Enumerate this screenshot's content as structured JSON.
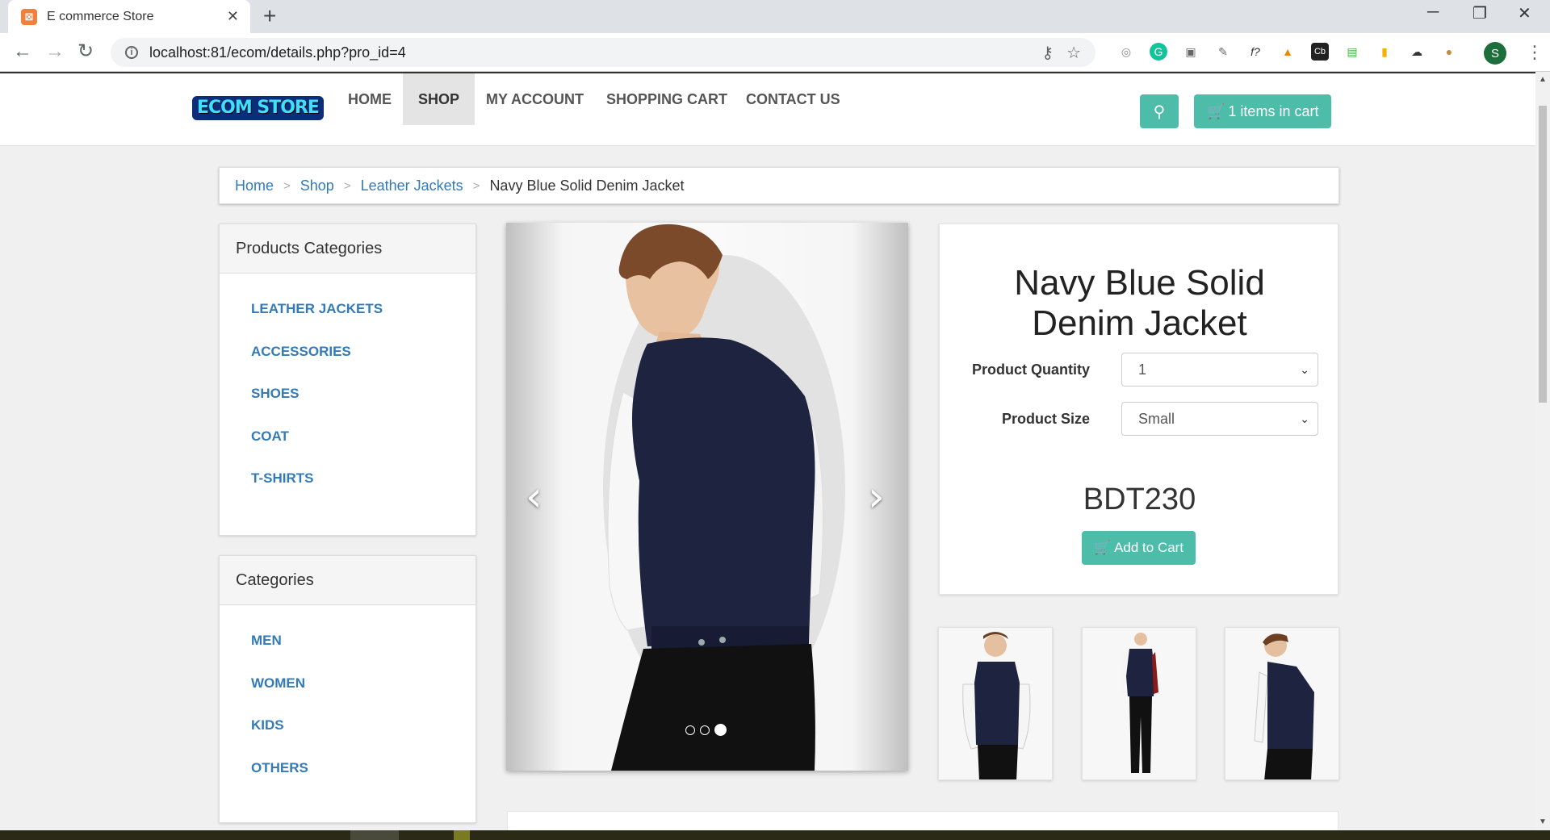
{
  "browser": {
    "tab_title": "E commerce Store",
    "favicon": "xampp-icon",
    "url": "localhost:81/ecom/details.php?pro_id=4",
    "profile_initial": "S"
  },
  "navbar": {
    "logo_text": "ECOM STORE",
    "menu": [
      {
        "label": "HOME",
        "active": false
      },
      {
        "label": "SHOP",
        "active": true
      },
      {
        "label": "MY ACCOUNT",
        "active": false
      },
      {
        "label": "SHOPPING CART",
        "active": false
      },
      {
        "label": "CONTACT US",
        "active": false
      }
    ],
    "cart_label": "1 items in cart"
  },
  "breadcrumb": {
    "items": [
      "Home",
      "Shop",
      "Leather Jackets"
    ],
    "current": "Navy Blue Solid Denim Jacket",
    "separator": ">"
  },
  "sidebar": {
    "product_categories": {
      "title": "Products Categories",
      "items": [
        "LEATHER JACKETS",
        "ACCESSORIES",
        "SHOES",
        "COAT",
        "T-SHIRTS"
      ]
    },
    "categories": {
      "title": "Categories",
      "items": [
        "MEN",
        "WOMEN",
        "KIDS",
        "OTHERS"
      ]
    }
  },
  "carousel": {
    "slide_count": 3,
    "active_index": 2
  },
  "product": {
    "title_line1": "Navy Blue Solid",
    "title_line2": "Denim Jacket",
    "quantity_label": "Product Quantity",
    "quantity_value": "1",
    "size_label": "Product Size",
    "size_value": "Small",
    "price": "BDT230",
    "add_to_cart_label": "Add to Cart"
  },
  "colors": {
    "accent": "#4dbdaa",
    "link": "#337ab7",
    "jacket": "#1e2340"
  }
}
